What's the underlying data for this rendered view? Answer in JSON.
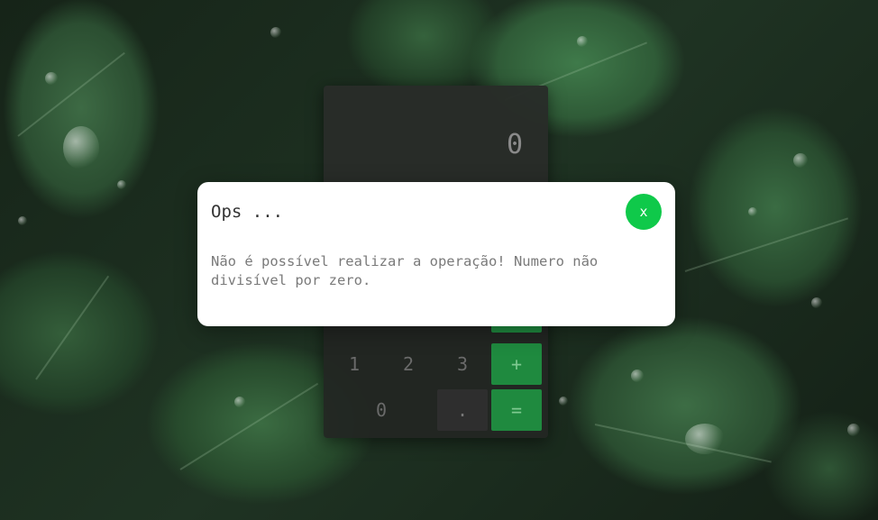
{
  "calculator": {
    "display": "0",
    "keys": {
      "one": "1",
      "two": "2",
      "three": "3",
      "plus": "+",
      "zero": "0",
      "dot": ".",
      "equals": "="
    }
  },
  "modal": {
    "title": "Ops ...",
    "close_label": "x",
    "message": "Não é possível realizar a operação! Numero não divisível por zero."
  },
  "colors": {
    "accent_green": "#0fc94a",
    "operator_key": "#1f8a3f",
    "modal_bg": "#ffffff"
  },
  "icons": {
    "close": "close-icon"
  }
}
